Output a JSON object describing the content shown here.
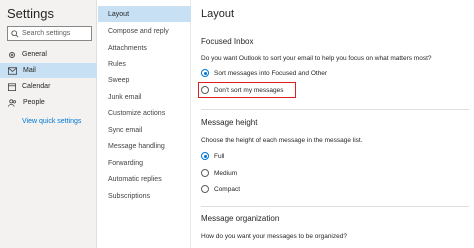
{
  "settings": {
    "title": "Settings",
    "search_placeholder": "Search settings",
    "nav": [
      {
        "label": "General",
        "icon": "gear-icon"
      },
      {
        "label": "Mail",
        "icon": "mail-icon"
      },
      {
        "label": "Calendar",
        "icon": "calendar-icon"
      },
      {
        "label": "People",
        "icon": "people-icon"
      }
    ],
    "quick_settings": "View quick settings"
  },
  "mail_menu": [
    "Layout",
    "Compose and reply",
    "Attachments",
    "Rules",
    "Sweep",
    "Junk email",
    "Customize actions",
    "Sync email",
    "Message handling",
    "Forwarding",
    "Automatic replies",
    "Subscriptions"
  ],
  "layout": {
    "title": "Layout",
    "focused_inbox": {
      "heading": "Focused Inbox",
      "question": "Do you want Outlook to sort your email to help you focus on what matters most?",
      "options": [
        "Sort messages into Focused and Other",
        "Don't sort my messages"
      ]
    },
    "message_height": {
      "heading": "Message height",
      "question": "Choose the height of each message in the message list.",
      "options": [
        "Full",
        "Medium",
        "Compact"
      ]
    },
    "message_org": {
      "heading": "Message organization",
      "question": "How do you want your messages to be organized?"
    }
  },
  "colors": {
    "accent": "#0078d4",
    "selected": "#c7e0f4",
    "highlight": "#e01e1e"
  }
}
